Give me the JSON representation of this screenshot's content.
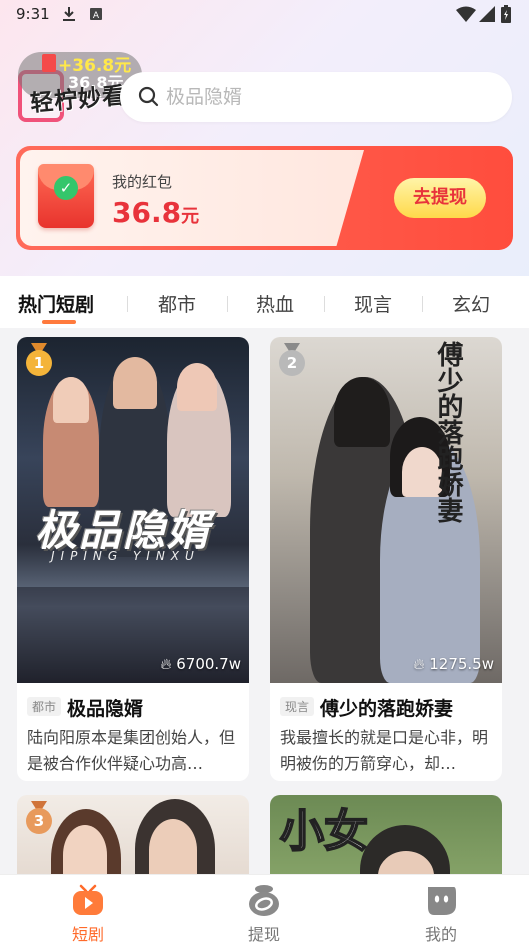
{
  "status_bar": {
    "time": "9:31"
  },
  "header": {
    "coin_bubble": {
      "plus": "+36.8元",
      "amount": "36.8元"
    },
    "logo_text": "轻柠妙看",
    "search": {
      "placeholder": "极品隐婿"
    }
  },
  "wallet": {
    "label": "我的红包",
    "amount": "36.8",
    "unit": "元",
    "withdraw_label": "去提现"
  },
  "tabs": [
    {
      "label": "热门短剧",
      "active": true
    },
    {
      "label": "都市"
    },
    {
      "label": "热血"
    },
    {
      "label": "现言"
    },
    {
      "label": "玄幻"
    }
  ],
  "dramas": [
    {
      "rank": "1",
      "poster_title": "极品隐婿",
      "poster_subtitle": "JIPING YINXU",
      "plays": "6700.7w",
      "tag": "都市",
      "title": "极品隐婿",
      "desc": "陆向阳原本是集团创始人，但是被合作伙伴疑心功高…"
    },
    {
      "rank": "2",
      "poster_title": "傅少的落跑娇妻",
      "plays": "1275.5w",
      "tag": "现言",
      "title": "傅少的落跑娇妻",
      "desc": "我最擅长的就是口是心非，明明被伤的万箭穿心，却…"
    },
    {
      "rank": "3"
    },
    {
      "poster_title": "小女"
    }
  ],
  "bottom_nav": [
    {
      "label": "短剧",
      "icon": "tv-icon",
      "active": true
    },
    {
      "label": "提现",
      "icon": "money-bag-icon"
    },
    {
      "label": "我的",
      "icon": "profile-icon"
    }
  ],
  "colors": {
    "accent": "#ff6a2a",
    "wallet_red": "#e8333b",
    "withdraw_yellow": "#ffd94a"
  }
}
